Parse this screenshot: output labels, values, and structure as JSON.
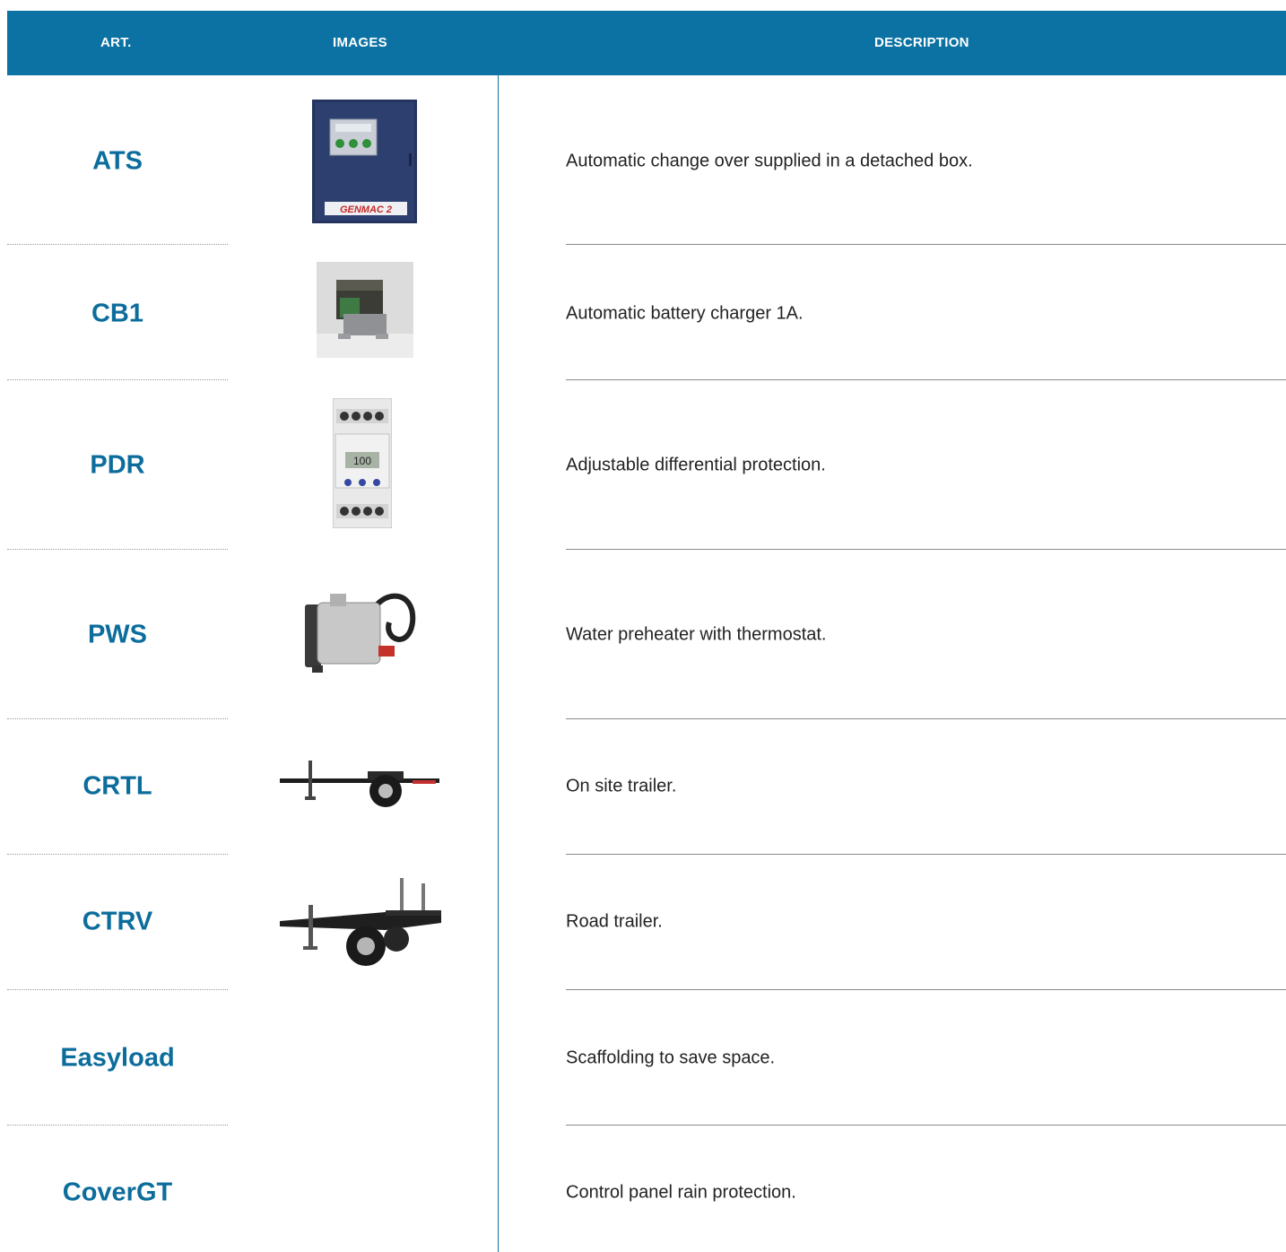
{
  "header": {
    "art": "ART.",
    "images": "IMAGES",
    "description": "DESCRIPTION"
  },
  "rows": [
    {
      "art": "ATS",
      "description": "Automatic change over supplied in a detached box.",
      "image": "ats-box-image",
      "image_text": "GENMAC 2"
    },
    {
      "art": "CB1",
      "description": "Automatic battery charger 1A.",
      "image": "battery-charger-image"
    },
    {
      "art": "PDR",
      "description": "Adjustable differential protection.",
      "image": "differential-relay-image",
      "image_text": "100"
    },
    {
      "art": "PWS",
      "description": "Water preheater with thermostat.",
      "image": "water-preheater-image"
    },
    {
      "art": "CRTL",
      "description": "On site trailer.",
      "image": "site-trailer-image"
    },
    {
      "art": "CTRV",
      "description": "Road trailer.",
      "image": "road-trailer-image"
    },
    {
      "art": "Easyload",
      "description": "Scaffolding to save space."
    },
    {
      "art": "CoverGT",
      "description": "Control panel rain protection."
    }
  ],
  "colors": {
    "header_bg": "#0c72a3",
    "art_text": "#0c6d9c",
    "separator": "#0c72a3"
  }
}
